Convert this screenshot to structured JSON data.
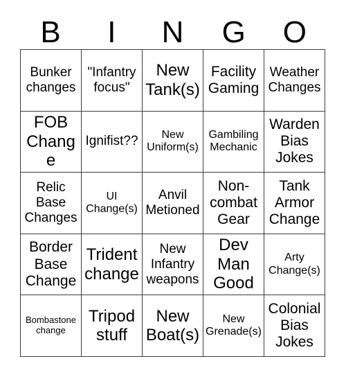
{
  "header": {
    "letters": [
      "B",
      "I",
      "N",
      "G",
      "O"
    ]
  },
  "grid": {
    "rows": [
      [
        {
          "text": "Bunker changes",
          "size": "md"
        },
        {
          "text": "\"Infantry focus\"",
          "size": "md"
        },
        {
          "text": "New Tank(s)",
          "size": "xl"
        },
        {
          "text": "Facility Gaming",
          "size": "lg"
        },
        {
          "text": "Weather Changes",
          "size": "md"
        }
      ],
      [
        {
          "text": "FOB Change",
          "size": "xl"
        },
        {
          "text": "Ignifist??",
          "size": "md"
        },
        {
          "text": "New Uniform(s)",
          "size": "sm"
        },
        {
          "text": "Gambiling Mechanic",
          "size": "sm"
        },
        {
          "text": "Warden Bias Jokes",
          "size": "lg"
        }
      ],
      [
        {
          "text": "Relic Base Changes",
          "size": "md"
        },
        {
          "text": "UI Change(s)",
          "size": "sm"
        },
        {
          "text": "Anvil Metioned",
          "size": "md"
        },
        {
          "text": "Non-combat Gear",
          "size": "lg"
        },
        {
          "text": "Tank Armor Change",
          "size": "lg"
        }
      ],
      [
        {
          "text": "Border Base Change",
          "size": "lg"
        },
        {
          "text": "Trident change",
          "size": "xl"
        },
        {
          "text": "New Infantry weapons",
          "size": "md"
        },
        {
          "text": "Dev Man Good",
          "size": "xl"
        },
        {
          "text": "Arty Change(s)",
          "size": "sm"
        }
      ],
      [
        {
          "text": "Bombastone change",
          "size": "xs"
        },
        {
          "text": "Tripod stuff",
          "size": "xl"
        },
        {
          "text": "New Boat(s)",
          "size": "xl"
        },
        {
          "text": "New Grenade(s)",
          "size": "sm"
        },
        {
          "text": "Colonial Bias Jokes",
          "size": "lg"
        }
      ]
    ]
  },
  "colors": {
    "background": "#ffffff",
    "border": "#3c3c3c",
    "text": "#000000"
  }
}
